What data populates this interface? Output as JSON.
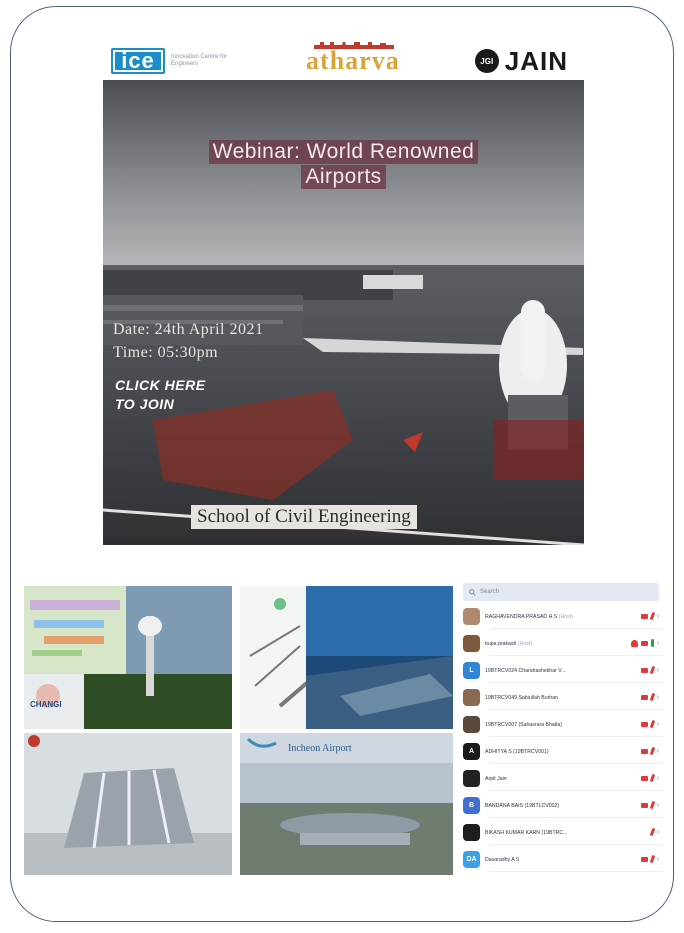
{
  "poster": {
    "ice_logo": "ice",
    "ice_sub": "Innovation Centre for Engineers",
    "atharva": "atharva",
    "jgi": "JGI",
    "jain": "JAIN",
    "title_line1": "Webinar: World Renowned",
    "title_line2": "Airports",
    "date": "Date: 24th April 2021",
    "time": "Time: 05:30pm",
    "cta_line1": "CLICK HERE",
    "cta_line2": "TO JOIN",
    "school": "School of Civil Engineering"
  },
  "tiles": {
    "changi_label": "CHANGI",
    "incheon_label": "Incheon Airport"
  },
  "participants": {
    "search_placeholder": "Search",
    "items": [
      {
        "name": "RAGHAVENDRA PRASAD H S",
        "role": "(Host)",
        "initial": "",
        "avatar_color": "#b08a6e",
        "cam_on": false,
        "mic_on": false
      },
      {
        "name": "bupa prakash",
        "role": "(Host)",
        "initial": "",
        "avatar_color": "#7d5a3c",
        "cam_on": false,
        "mic_on": true
      },
      {
        "name": "19BTRCV024 Chandrashekhar V...",
        "role": "",
        "initial": "L",
        "avatar_color": "#2f86d6",
        "cam_on": false,
        "mic_on": false
      },
      {
        "name": "19BTRCV049 Sabiullah Burhan",
        "role": "",
        "initial": "",
        "avatar_color": "#8a6a52",
        "cam_on": false,
        "mic_on": false
      },
      {
        "name": "19BTRCV007 (Sahasrara Bhatla)",
        "role": "",
        "initial": "",
        "avatar_color": "#5a4a3e",
        "cam_on": false,
        "mic_on": false
      },
      {
        "name": "ADHITYA S (19BTRCV001)",
        "role": "",
        "initial": "A",
        "avatar_color": "#1a1a1a",
        "cam_on": false,
        "mic_on": false
      },
      {
        "name": "Arpit Jain",
        "role": "",
        "initial": "",
        "avatar_color": "#222222",
        "cam_on": false,
        "mic_on": false
      },
      {
        "name": "BANDANA BAIS (19BTLCV002)",
        "role": "",
        "initial": "B",
        "avatar_color": "#3f6fd1",
        "cam_on": false,
        "mic_on": false
      },
      {
        "name": "BIKASH KUMAR KARN (19BTRC...",
        "role": "",
        "initial": "",
        "avatar_color": "#1e1e1e",
        "cam_on": null,
        "mic_on": false
      },
      {
        "name": "Dasaradhy A S",
        "role": "",
        "initial": "DA",
        "avatar_color": "#3aa0e8",
        "cam_on": false,
        "mic_on": false
      }
    ]
  }
}
